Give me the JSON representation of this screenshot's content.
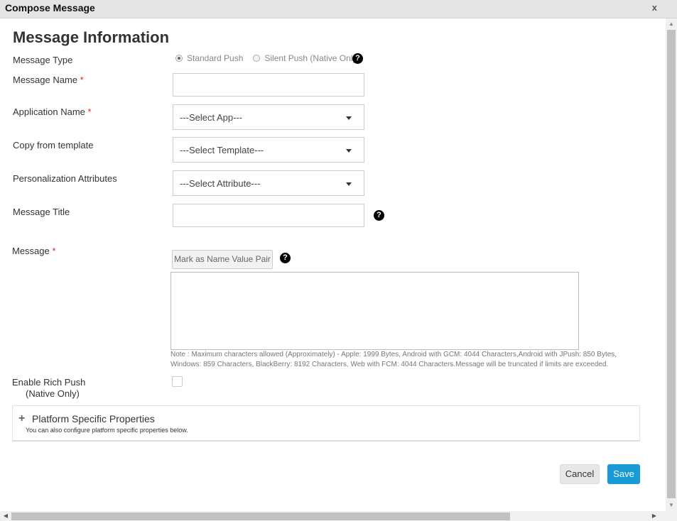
{
  "window": {
    "title": "Compose Message",
    "close_label": "x"
  },
  "form": {
    "heading": "Message Information",
    "message_type": {
      "label": "Message Type",
      "options": [
        {
          "label": "Standard Push",
          "selected": true
        },
        {
          "label": "Silent Push (Native Only)",
          "selected": false
        }
      ]
    },
    "message_name": {
      "label": "Message Name",
      "required_mark": "*",
      "value": ""
    },
    "application_name": {
      "label": "Application Name",
      "required_mark": "*",
      "selected": "---Select App---"
    },
    "copy_template": {
      "label": "Copy from template",
      "selected": "---Select Template---"
    },
    "personalization": {
      "label": "Personalization Attributes",
      "selected": "---Select Attribute---"
    },
    "message_title": {
      "label": "Message Title",
      "value": ""
    },
    "message": {
      "label": "Message",
      "required_mark": "*",
      "mark_button_label": "Mark as Name Value Pair",
      "value": "",
      "note_line1": "Note : Maximum characters allowed (Approximately) - Apple: 1999 Bytes, Android with GCM: 4044 Characters,Android with JPush: 850 Bytes,",
      "note_line2": "Windows: 859 Characters, BlackBerry: 8192 Characters, Web with FCM: 4044 Characters.Message will be truncated if limits are exceeded."
    },
    "rich_push": {
      "label_line1": "Enable Rich Push",
      "label_line2": "(Native Only)",
      "checked": false
    },
    "platform_panel": {
      "expand_glyph": "+",
      "title": "Platform Specific Properties",
      "subtitle": "You can also configure platform specific properties below."
    },
    "help_glyph": "?"
  },
  "actions": {
    "cancel_label": "Cancel",
    "save_label": "Save"
  },
  "colors": {
    "accent": "#1a9bd7",
    "required": "#d9221c",
    "titlebar": "#e5e5e5"
  }
}
